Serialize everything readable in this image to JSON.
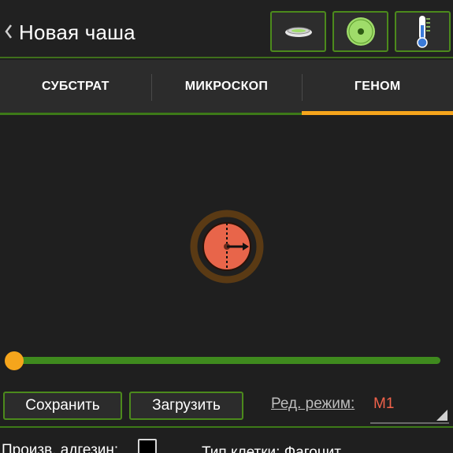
{
  "header": {
    "back_glyph": "‹",
    "title": "Новая чаша",
    "buttons": [
      {
        "name": "dish-icon"
      },
      {
        "name": "well-icon"
      },
      {
        "name": "thermometer-icon"
      }
    ]
  },
  "tabs": [
    {
      "label": "СУБСТРАТ",
      "active": false
    },
    {
      "label": "МИКРОСКОП",
      "active": false
    },
    {
      "label": "ГЕНОМ",
      "active": true
    }
  ],
  "slider": {
    "value": 0
  },
  "controls": {
    "save_label": "Сохранить",
    "load_label": "Загрузить",
    "mode_label": "Ред. режим:",
    "mode_value": "M1"
  },
  "footer": {
    "adhesin_label": "Произв. адгезин:",
    "adhesin_checked": false,
    "cell_type_label": "Тип клетки:",
    "cell_type_value": "Фагоцит"
  },
  "colors": {
    "accent_green": "#4c8a1c",
    "accent_orange": "#f5a51c",
    "cell_fill": "#e8654a",
    "mode_value": "#f0624a"
  }
}
